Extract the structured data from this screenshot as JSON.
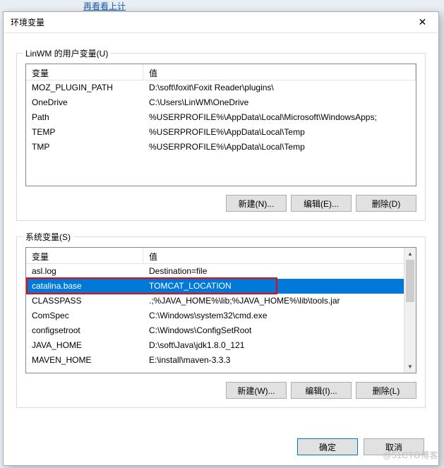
{
  "stray_text": "再看看上计",
  "dialog": {
    "title": "环境变量",
    "close_icon": "✕"
  },
  "user_section": {
    "label": "LinWM 的用户变量(U)",
    "header_var": "变量",
    "header_val": "值",
    "rows": [
      {
        "var": "MOZ_PLUGIN_PATH",
        "val": "D:\\soft\\foxit\\Foxit Reader\\plugins\\"
      },
      {
        "var": "OneDrive",
        "val": "C:\\Users\\LinWM\\OneDrive"
      },
      {
        "var": "Path",
        "val": "%USERPROFILE%\\AppData\\Local\\Microsoft\\WindowsApps;"
      },
      {
        "var": "TEMP",
        "val": "%USERPROFILE%\\AppData\\Local\\Temp"
      },
      {
        "var": "TMP",
        "val": "%USERPROFILE%\\AppData\\Local\\Temp"
      }
    ],
    "buttons": {
      "new": "新建(N)...",
      "edit": "编辑(E)...",
      "delete": "删除(D)"
    }
  },
  "system_section": {
    "label": "系统变量(S)",
    "header_var": "变量",
    "header_val": "值",
    "rows": [
      {
        "var": "asl.log",
        "val": "Destination=file"
      },
      {
        "var": "catalina.base",
        "val": "TOMCAT_LOCATION"
      },
      {
        "var": "CLASSPASS",
        "val": ".;%JAVA_HOME%\\lib;%JAVA_HOME%\\lib\\tools.jar"
      },
      {
        "var": "ComSpec",
        "val": "C:\\Windows\\system32\\cmd.exe"
      },
      {
        "var": "configsetroot",
        "val": "C:\\Windows\\ConfigSetRoot"
      },
      {
        "var": "JAVA_HOME",
        "val": "D:\\soft\\Java\\jdk1.8.0_121"
      },
      {
        "var": "MAVEN_HOME",
        "val": "E:\\install\\maven-3.3.3"
      }
    ],
    "selected_index": 1,
    "buttons": {
      "new": "新建(W)...",
      "edit": "编辑(I)...",
      "delete": "删除(L)"
    },
    "scroll_arrows": {
      "up": "▲",
      "down": "▼"
    }
  },
  "footer": {
    "ok": "确定",
    "cancel": "取消"
  },
  "watermark": "@51CTO博客"
}
